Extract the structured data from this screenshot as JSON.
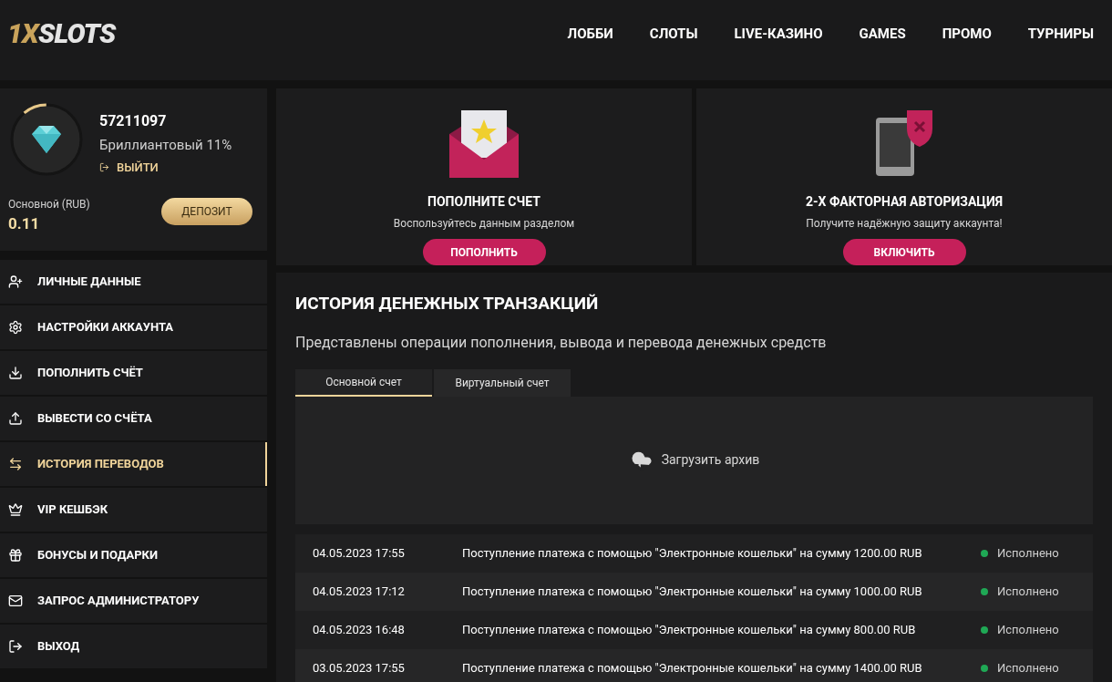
{
  "logo": {
    "part_1": "1X",
    "part_2": "SLOTS"
  },
  "nav": [
    {
      "label": "ЛОББИ"
    },
    {
      "label": "СЛОТЫ"
    },
    {
      "label": "LIVE-КАЗИНО"
    },
    {
      "label": "GAMES"
    },
    {
      "label": "ПРОМО"
    },
    {
      "label": "ТУРНИРЫ"
    }
  ],
  "profile": {
    "id": "57211097",
    "status": "Бриллиантовый 11%",
    "level": 0.11,
    "logout": "ВЫЙТИ",
    "balance_label": "Основной (RUB)",
    "balance": "0.11",
    "deposit_button": "ДЕПОЗИТ"
  },
  "menu": [
    {
      "label": "ЛИЧНЫЕ ДАННЫЕ",
      "kind": "user-plus",
      "selected": false
    },
    {
      "label": "НАСТРОЙКИ АККАУНТА",
      "kind": "gears",
      "selected": false
    },
    {
      "label": "ПОПОЛНИТЬ СЧЁТ",
      "kind": "download",
      "selected": false
    },
    {
      "label": "ВЫВЕСТИ СО СЧЁТА",
      "kind": "upload",
      "selected": false
    },
    {
      "label": "ИСТОРИЯ ПЕРЕВОДОВ",
      "kind": "transfer",
      "selected": true
    },
    {
      "label": "VIP КЕШБЭК",
      "kind": "crown",
      "selected": false
    },
    {
      "label": "БОНУСЫ И ПОДАРКИ",
      "kind": "gift",
      "selected": false
    },
    {
      "label": "ЗАПРОС АДМИНИСТРАТОРУ",
      "kind": "mail",
      "selected": false
    },
    {
      "label": "ВЫХОД",
      "kind": "logout",
      "selected": false
    }
  ],
  "promo_cards": [
    {
      "kind": "envelope",
      "title": "ПОПОЛНИТЕ СЧЕТ",
      "text": "Воспользуйтесь данным разделом",
      "button": "ПОПОЛНИТЬ"
    },
    {
      "kind": "phone",
      "title": "2-Х ФАКТОРНАЯ АВТОРИЗАЦИЯ",
      "text": "Получите надёжную защиту аккаунта!",
      "button": "ВКЛЮЧИТЬ"
    }
  ],
  "history": {
    "title": "ИСТОРИЯ ДЕНЕЖНЫХ ТРАНЗАКЦИЙ",
    "subtitle": "Представлены операции пополнения, вывода и перевода денежных средств",
    "tabs": [
      {
        "label": "Основной счет",
        "selected": true
      },
      {
        "label": "Виртуальный счет",
        "selected": false
      }
    ],
    "archive_button": "Загрузить архив",
    "rows": [
      {
        "date": "04.05.2023 17:55",
        "description": "Поступление платежа с помощью \"Электронные кошельки\" на сумму 1200.00 RUB",
        "status": "Исполнено"
      },
      {
        "date": "04.05.2023 17:12",
        "description": "Поступление платежа с помощью \"Электронные кошельки\" на сумму 1000.00 RUB",
        "status": "Исполнено"
      },
      {
        "date": "04.05.2023 16:48",
        "description": "Поступление платежа с помощью \"Электронные кошельки\" на сумму 800.00 RUB",
        "status": "Исполнено"
      },
      {
        "date": "03.05.2023 17:55",
        "description": "Поступление платежа с помощью \"Электронные кошельки\" на сумму 1400.00 RUB",
        "status": "Исполнено"
      }
    ]
  }
}
